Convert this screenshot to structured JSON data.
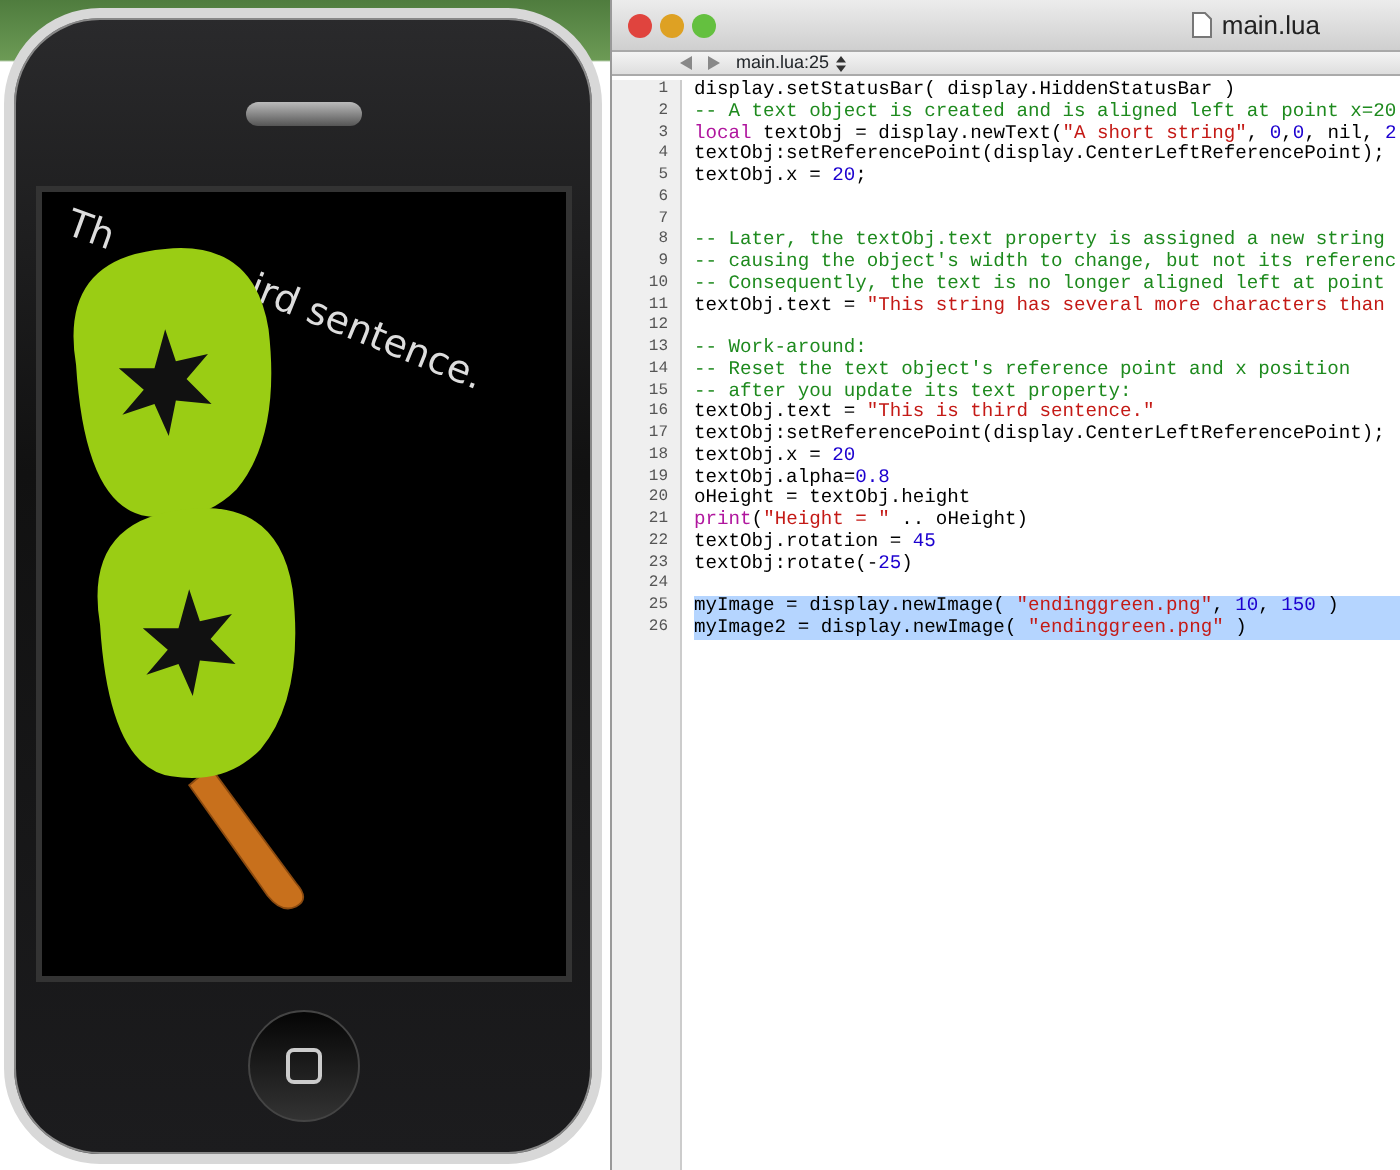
{
  "simulator": {
    "screen_texts": [
      "Th",
      "ird sentence."
    ]
  },
  "editor": {
    "title": "main.lua",
    "jump_bar": "main.lua:25",
    "lines": [
      {
        "number": "1",
        "selected": false,
        "tokens": [
          {
            "kind": "plain",
            "text": "display.setStatusBar( display.HiddenStatusBar )"
          }
        ]
      },
      {
        "number": "2",
        "selected": false,
        "tokens": [
          {
            "kind": "comment",
            "text": "-- A text object is created and is aligned left at point x=20"
          }
        ]
      },
      {
        "number": "3",
        "selected": false,
        "tokens": [
          {
            "kind": "keyword",
            "text": "local"
          },
          {
            "kind": "plain",
            "text": " textObj = display.newText("
          },
          {
            "kind": "string",
            "text": "\"A short string\""
          },
          {
            "kind": "plain",
            "text": ", "
          },
          {
            "kind": "number",
            "text": "0"
          },
          {
            "kind": "plain",
            "text": ","
          },
          {
            "kind": "number",
            "text": "0"
          },
          {
            "kind": "plain",
            "text": ", nil, "
          },
          {
            "kind": "number",
            "text": "2"
          }
        ]
      },
      {
        "number": "4",
        "selected": false,
        "tokens": [
          {
            "kind": "plain",
            "text": "textObj:setReferencePoint(display.CenterLeftReferencePoint);"
          }
        ]
      },
      {
        "number": "5",
        "selected": false,
        "tokens": [
          {
            "kind": "plain",
            "text": "textObj.x = "
          },
          {
            "kind": "number",
            "text": "20"
          },
          {
            "kind": "plain",
            "text": ";"
          }
        ]
      },
      {
        "number": "6",
        "selected": false
      },
      {
        "number": "7",
        "selected": false
      },
      {
        "number": "8",
        "selected": false,
        "tokens": [
          {
            "kind": "comment",
            "text": "-- Later, the textObj.text property is assigned a new string"
          }
        ]
      },
      {
        "number": "9",
        "selected": false,
        "tokens": [
          {
            "kind": "comment",
            "text": "-- causing the object's width to change, but not its referenc"
          }
        ]
      },
      {
        "number": "10",
        "selected": false,
        "tokens": [
          {
            "kind": "comment",
            "text": "-- Consequently, the text is no longer aligned left at point"
          }
        ]
      },
      {
        "number": "11",
        "selected": false,
        "tokens": [
          {
            "kind": "plain",
            "text": "textObj.text = "
          },
          {
            "kind": "string",
            "text": "\"This string has several more characters than"
          }
        ]
      },
      {
        "number": "12",
        "selected": false
      },
      {
        "number": "13",
        "selected": false,
        "tokens": [
          {
            "kind": "comment",
            "text": "-- Work-around:"
          }
        ]
      },
      {
        "number": "14",
        "selected": false,
        "tokens": [
          {
            "kind": "comment",
            "text": "-- Reset the text object's reference point and x position"
          }
        ]
      },
      {
        "number": "15",
        "selected": false,
        "tokens": [
          {
            "kind": "comment",
            "text": "-- after you update its text property:"
          }
        ]
      },
      {
        "number": "16",
        "selected": false,
        "tokens": [
          {
            "kind": "plain",
            "text": "textObj.text = "
          },
          {
            "kind": "string",
            "text": "\"This is third sentence.\""
          }
        ]
      },
      {
        "number": "17",
        "selected": false,
        "tokens": [
          {
            "kind": "plain",
            "text": "textObj:setReferencePoint(display.CenterLeftReferencePoint);"
          }
        ]
      },
      {
        "number": "18",
        "selected": false,
        "tokens": [
          {
            "kind": "plain",
            "text": "textObj.x = "
          },
          {
            "kind": "number",
            "text": "20"
          }
        ]
      },
      {
        "number": "19",
        "selected": false,
        "tokens": [
          {
            "kind": "plain",
            "text": "textObj.alpha="
          },
          {
            "kind": "number",
            "text": "0.8"
          }
        ]
      },
      {
        "number": "20",
        "selected": false,
        "tokens": [
          {
            "kind": "plain",
            "text": "oHeight = textObj.height"
          }
        ]
      },
      {
        "number": "21",
        "selected": false,
        "tokens": [
          {
            "kind": "keyword",
            "text": "print"
          },
          {
            "kind": "plain",
            "text": "("
          },
          {
            "kind": "string",
            "text": "\"Height = \""
          },
          {
            "kind": "plain",
            "text": " .. oHeight)"
          }
        ]
      },
      {
        "number": "22",
        "selected": false,
        "tokens": [
          {
            "kind": "plain",
            "text": "textObj.rotation = "
          },
          {
            "kind": "number",
            "text": "45"
          }
        ]
      },
      {
        "number": "23",
        "selected": false,
        "tokens": [
          {
            "kind": "plain",
            "text": "textObj:rotate(-"
          },
          {
            "kind": "number",
            "text": "25"
          },
          {
            "kind": "plain",
            "text": ")"
          }
        ]
      },
      {
        "number": "24",
        "selected": false
      },
      {
        "number": "25",
        "selected": true,
        "tokens": [
          {
            "kind": "plain",
            "text": "myImage = display.newImage( "
          },
          {
            "kind": "string",
            "text": "\"endinggreen.png\""
          },
          {
            "kind": "plain",
            "text": ", "
          },
          {
            "kind": "number",
            "text": "10"
          },
          {
            "kind": "plain",
            "text": ", "
          },
          {
            "kind": "number",
            "text": "150"
          },
          {
            "kind": "plain",
            "text": " )"
          }
        ]
      },
      {
        "number": "26",
        "selected": true,
        "tokens": [
          {
            "kind": "plain",
            "text": "myImage2 = display.newImage( "
          },
          {
            "kind": "string",
            "text": "\"endinggreen.png\""
          },
          {
            "kind": "plain",
            "text": " )"
          }
        ]
      }
    ]
  }
}
